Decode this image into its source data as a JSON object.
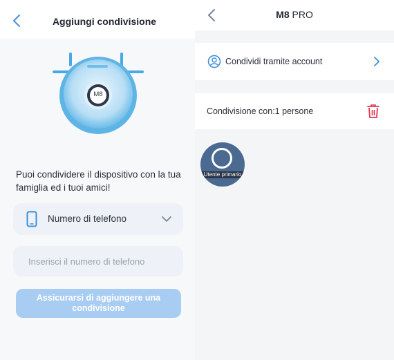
{
  "left": {
    "title": "Aggiungi condivisione",
    "robot_label": "M8",
    "description": "Puoi condividere il dispositivo con la tua famiglia ed i tuoi amici!",
    "contact_method": {
      "selected": "Numero di telefono",
      "icon": "phone-icon"
    },
    "phone_input": {
      "value": "",
      "placeholder": "Inserisci il numero di telefono"
    },
    "confirm_button": "Assicurarsi di aggiungere una condivisione"
  },
  "right": {
    "title_model": "M8",
    "title_suffix": "PRO",
    "share_by_account": "Condividi tramite account",
    "shared_with": "Condivisione con:1 persone",
    "users": [
      {
        "role": "Utente primario"
      }
    ]
  },
  "colors": {
    "accent": "#3e8fd8",
    "button_disabled": "#a9cdf2",
    "delete": "#e0344e",
    "field_bg": "#eef2f8"
  }
}
